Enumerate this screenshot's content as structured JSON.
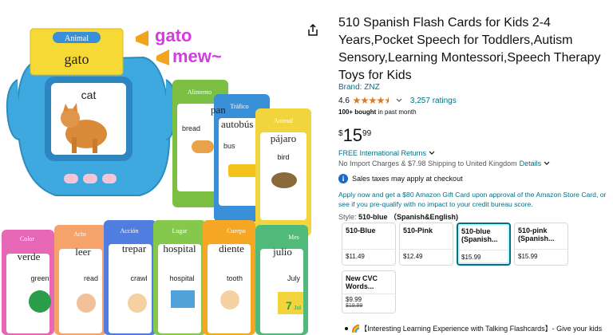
{
  "product": {
    "title": "510 Spanish Flash Cards for Kids 2-4 Years,Pocket Speech for Toddlers,Autism Sensory,Learning Montessori,Speech Therapy Toys for Kids",
    "brand": "Brand: ZNZ",
    "rating": "4.6",
    "rating_count": "3,257 ratings",
    "bought_bold": "100+ bought",
    "bought_rest": " in past month",
    "price_currency": "$",
    "price_whole": "15",
    "price_fraction": "99",
    "returns": "FREE International Returns",
    "shipping": "No Import Charges & $7.98 Shipping to United Kingdom",
    "details": "Details",
    "tax": "Sales taxes may apply at checkout",
    "card_offer": "Apply now and get a $80 Amazon Gift Card upon approval of the Amazon Store Card, or see if you pre-qualify with no impact to your credit bureau score.",
    "style_label": "Style: ",
    "style_value": "510-blue （Spanish&English)",
    "bullet": "🌈【Interesting Learning Experience with Talking Flashcards】- Give your kids"
  },
  "options": [
    {
      "name": "510-Blue",
      "price": "$11.49"
    },
    {
      "name": "510-Pink",
      "price": "$12.49"
    },
    {
      "name": "510-blue (Spanish...",
      "price": "$15.99"
    },
    {
      "name": "510-pink (Spanish...",
      "price": "$15.99"
    },
    {
      "name": "New CVC Words...",
      "price": "$9.99",
      "old_price": "$19.99"
    }
  ],
  "image": {
    "bubble1": "gato",
    "bubble2": "mew~",
    "card_top_cat": "Animal",
    "card_top_word": "gato",
    "screen_word": "cat",
    "cards": [
      {
        "cat": "Alimento",
        "word": "pan",
        "eng": "bread",
        "color": "#7bc043"
      },
      {
        "cat": "Tráfico",
        "word": "autobús",
        "eng": "bus",
        "color": "#3a8fd9"
      },
      {
        "cat": "Animal",
        "word": "pájaro",
        "eng": "bird",
        "color": "#f2d43c"
      },
      {
        "cat": "Color",
        "word": "verde",
        "eng": "green",
        "color": "#e567b5"
      },
      {
        "cat": "Acto",
        "word": "leer",
        "eng": "read",
        "color": "#f5a36b"
      },
      {
        "cat": "Acción",
        "word": "trepar",
        "eng": "crawl",
        "color": "#4f7de0"
      },
      {
        "cat": "Lugar",
        "word": "hospital",
        "eng": "hospital",
        "color": "#84c94b"
      },
      {
        "cat": "Cuerpo",
        "word": "diente",
        "eng": "tooth",
        "color": "#f5a623"
      },
      {
        "cat": "Mes",
        "word": "julio",
        "eng": "July",
        "color": "#4fba7a"
      }
    ],
    "july_num": "7",
    "july_abbr": "Jul"
  }
}
